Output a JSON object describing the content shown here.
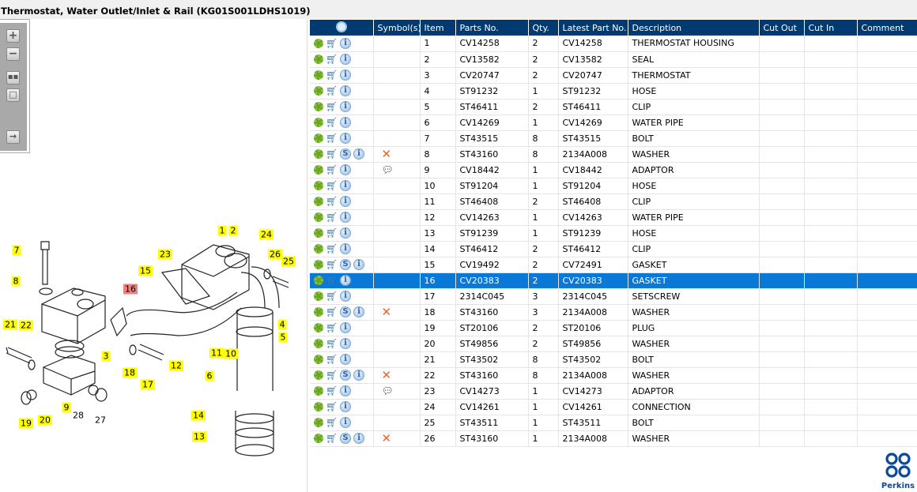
{
  "title": "Thermostat, Water Outlet/Inlet & Rail (KG01S001LDHS1019)",
  "toolbar": [
    "zoom-in",
    "zoom-out",
    "fit-all",
    "fit-window",
    "toggle-panel"
  ],
  "headers": [
    "",
    "Symbol(s)",
    "Item",
    "Parts No.",
    "Qty.",
    "Latest Part No.",
    "Description",
    "Cut Out",
    "Cut In",
    "Comment"
  ],
  "selected_item": "16",
  "rows": [
    {
      "item": "1",
      "part": "CV14258",
      "qty": "2",
      "latest": "CV14258",
      "desc": "THERMOSTAT HOUSING",
      "s": false,
      "sym": ""
    },
    {
      "item": "2",
      "part": "CV13582",
      "qty": "2",
      "latest": "CV13582",
      "desc": "SEAL",
      "s": false,
      "sym": ""
    },
    {
      "item": "3",
      "part": "CV20747",
      "qty": "2",
      "latest": "CV20747",
      "desc": "THERMOSTAT",
      "s": false,
      "sym": ""
    },
    {
      "item": "4",
      "part": "ST91232",
      "qty": "1",
      "latest": "ST91232",
      "desc": "HOSE",
      "s": false,
      "sym": ""
    },
    {
      "item": "5",
      "part": "ST46411",
      "qty": "2",
      "latest": "ST46411",
      "desc": "CLIP",
      "s": false,
      "sym": ""
    },
    {
      "item": "6",
      "part": "CV14269",
      "qty": "1",
      "latest": "CV14269",
      "desc": "WATER PIPE",
      "s": false,
      "sym": ""
    },
    {
      "item": "7",
      "part": "ST43515",
      "qty": "8",
      "latest": "ST43515",
      "desc": "BOLT",
      "s": false,
      "sym": ""
    },
    {
      "item": "8",
      "part": "ST43160",
      "qty": "8",
      "latest": "2134A008",
      "desc": "WASHER",
      "s": true,
      "sym": "x"
    },
    {
      "item": "9",
      "part": "CV18442",
      "qty": "1",
      "latest": "CV18442",
      "desc": "ADAPTOR",
      "s": false,
      "sym": "comment"
    },
    {
      "item": "10",
      "part": "ST91204",
      "qty": "1",
      "latest": "ST91204",
      "desc": "HOSE",
      "s": false,
      "sym": ""
    },
    {
      "item": "11",
      "part": "ST46408",
      "qty": "2",
      "latest": "ST46408",
      "desc": "CLIP",
      "s": false,
      "sym": ""
    },
    {
      "item": "12",
      "part": "CV14263",
      "qty": "1",
      "latest": "CV14263",
      "desc": "WATER PIPE",
      "s": false,
      "sym": ""
    },
    {
      "item": "13",
      "part": "ST91239",
      "qty": "1",
      "latest": "ST91239",
      "desc": "HOSE",
      "s": false,
      "sym": ""
    },
    {
      "item": "14",
      "part": "ST46412",
      "qty": "2",
      "latest": "ST46412",
      "desc": "CLIP",
      "s": false,
      "sym": ""
    },
    {
      "item": "15",
      "part": "CV19492",
      "qty": "2",
      "latest": "CV72491",
      "desc": "GASKET",
      "s": true,
      "sym": ""
    },
    {
      "item": "16",
      "part": "CV20383",
      "qty": "2",
      "latest": "CV20383",
      "desc": "GASKET",
      "s": false,
      "sym": ""
    },
    {
      "item": "17",
      "part": "2314C045",
      "qty": "3",
      "latest": "2314C045",
      "desc": "SETSCREW",
      "s": false,
      "sym": ""
    },
    {
      "item": "18",
      "part": "ST43160",
      "qty": "3",
      "latest": "2134A008",
      "desc": "WASHER",
      "s": true,
      "sym": "x"
    },
    {
      "item": "19",
      "part": "ST20106",
      "qty": "2",
      "latest": "ST20106",
      "desc": "PLUG",
      "s": false,
      "sym": ""
    },
    {
      "item": "20",
      "part": "ST49856",
      "qty": "2",
      "latest": "ST49856",
      "desc": "WASHER",
      "s": false,
      "sym": ""
    },
    {
      "item": "21",
      "part": "ST43502",
      "qty": "8",
      "latest": "ST43502",
      "desc": "BOLT",
      "s": false,
      "sym": ""
    },
    {
      "item": "22",
      "part": "ST43160",
      "qty": "8",
      "latest": "2134A008",
      "desc": "WASHER",
      "s": true,
      "sym": "x"
    },
    {
      "item": "23",
      "part": "CV14273",
      "qty": "1",
      "latest": "CV14273",
      "desc": "ADAPTOR",
      "s": false,
      "sym": "comment"
    },
    {
      "item": "24",
      "part": "CV14261",
      "qty": "1",
      "latest": "CV14261",
      "desc": "CONNECTION",
      "s": false,
      "sym": ""
    },
    {
      "item": "25",
      "part": "ST43511",
      "qty": "1",
      "latest": "ST43511",
      "desc": "BOLT",
      "s": false,
      "sym": ""
    },
    {
      "item": "26",
      "part": "ST43160",
      "qty": "1",
      "latest": "2134A008",
      "desc": "WASHER",
      "s": true,
      "sym": "x"
    }
  ],
  "callouts": [
    "1",
    "2",
    "24",
    "7",
    "23",
    "26",
    "25",
    "15",
    "8",
    "16",
    "4",
    "21",
    "22",
    "5",
    "3",
    "11",
    "10",
    "12",
    "6",
    "18",
    "17",
    "9",
    "28",
    "27",
    "19",
    "20",
    "14",
    "13"
  ],
  "logo": "Perkins",
  "colors": {
    "header": "#003a70",
    "selected": "#0a78d7",
    "callout": "#ffff00",
    "callout_selected": "#f08080"
  }
}
